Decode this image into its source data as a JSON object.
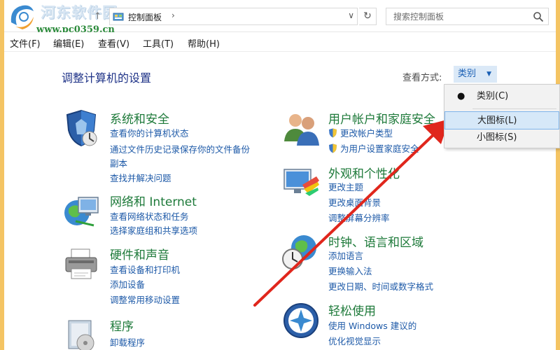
{
  "watermark": {
    "title": "河东软件园",
    "url": "www.pc0359.cn"
  },
  "address": {
    "path_label": "控制面板",
    "separator": "›",
    "dropdown": "∨",
    "refresh": "↻",
    "search_placeholder": "搜索控制面板"
  },
  "menu": {
    "items": [
      "文件(F)",
      "编辑(E)",
      "查看(V)",
      "工具(T)",
      "帮助(H)"
    ]
  },
  "content": {
    "title": "调整计算机的设置",
    "viewby_label": "查看方式:",
    "viewby_value": "类别"
  },
  "dropdown": {
    "items": [
      "类别(C)",
      "大图标(L)",
      "小图标(S)"
    ],
    "selected_index": 0,
    "highlighted_index": 1,
    "bullet": "●"
  },
  "categories": [
    {
      "title": "系统和安全",
      "links": [
        "查看你的计算机状态",
        "通过文件历史记录保存你的文件备份",
        "副本",
        "查找并解决问题"
      ]
    },
    {
      "title": "网络和 Internet",
      "links": [
        "查看网络状态和任务",
        "选择家庭组和共享选项"
      ]
    },
    {
      "title": "硬件和声音",
      "links": [
        "查看设备和打印机",
        "添加设备",
        "调整常用移动设置"
      ]
    },
    {
      "title": "程序",
      "links": [
        "卸载程序"
      ]
    },
    {
      "title": "用户帐户和家庭安全",
      "links": [
        "更改帐户类型",
        "为用户设置家庭安全"
      ]
    },
    {
      "title": "外观和个性化",
      "links": [
        "更改主题",
        "更改桌面背景",
        "调整屏幕分辨率"
      ]
    },
    {
      "title": "时钟、语言和区域",
      "links": [
        "添加语言",
        "更换输入法",
        "更改日期、时间或数字格式"
      ]
    },
    {
      "title": "轻松使用",
      "links": [
        "使用 Windows 建议的",
        "优化视觉显示"
      ]
    }
  ],
  "colors": {
    "accent_green": "#1e7a3a",
    "link_blue": "#1e5aa8",
    "arrow_red": "#e0261c",
    "frame": "#f4c463"
  }
}
